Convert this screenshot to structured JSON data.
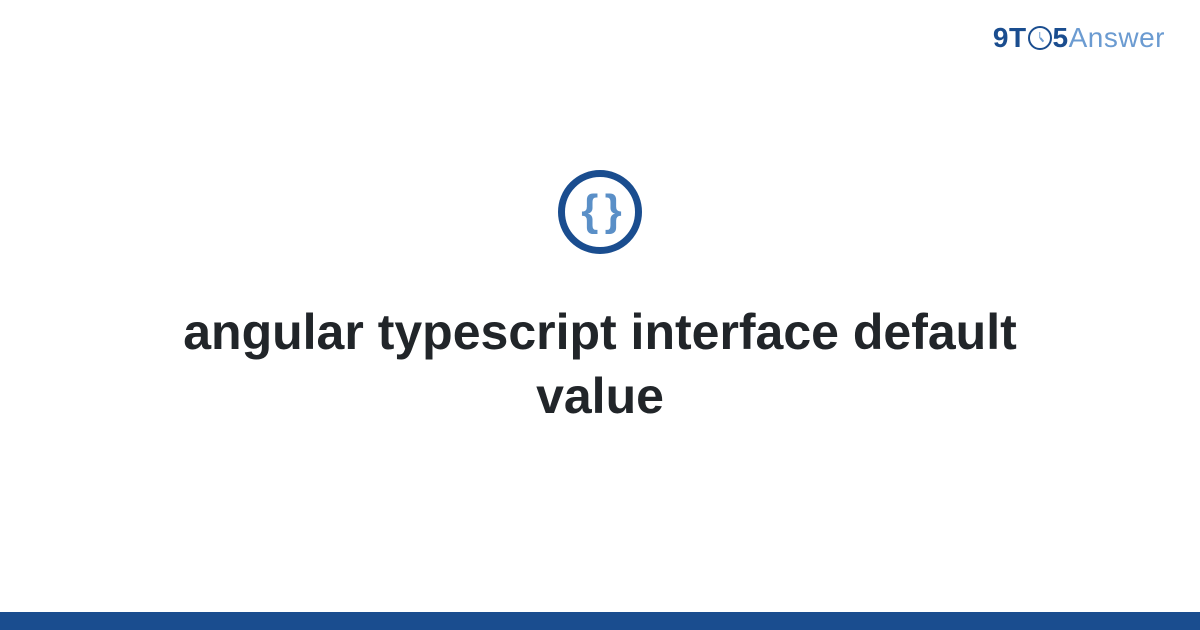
{
  "brand": {
    "part_nine": "9",
    "part_t": "T",
    "part_five": "5",
    "part_answer": "Answer"
  },
  "icon": {
    "braces": "{ }"
  },
  "page": {
    "title": "angular typescript interface default value"
  },
  "colors": {
    "brand_dark": "#1a4d8f",
    "brand_light": "#6b9bd1",
    "text": "#212529"
  }
}
